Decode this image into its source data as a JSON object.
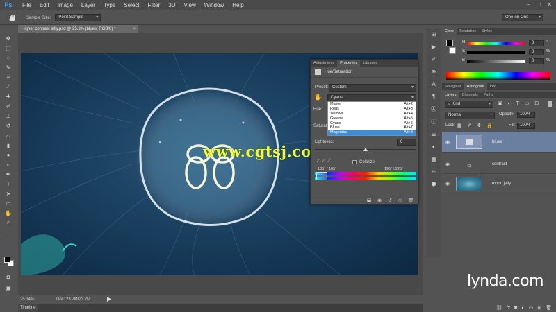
{
  "menu": {
    "logo": "Ps",
    "items": [
      "File",
      "Edit",
      "Image",
      "Layer",
      "Type",
      "Select",
      "Filter",
      "3D",
      "View",
      "Window",
      "Help"
    ]
  },
  "window_controls": [
    "–",
    "□",
    "✕"
  ],
  "options": {
    "sample_size_label": "Sample Size:",
    "sample_size_value": "Point Sample",
    "workspace": "One-on-One"
  },
  "document": {
    "tab_title": "Higher contrast jelly.psd @ 25.3% (blues, RGB/8) *",
    "tab_close": "×",
    "zoom": "25.34%",
    "doc_size": "Doc: 23.7M/23.7M",
    "watermark": "www.cgtsj.com"
  },
  "timeline_label": "Timeline",
  "properties": {
    "tabs": [
      "Adjustments",
      "Properties",
      "Libraries"
    ],
    "active_tab": "Properties",
    "title": "Hue/Saturation",
    "preset_label": "Preset:",
    "preset_value": "Custom",
    "channel_value": "Cyans",
    "channels": [
      {
        "name": "Master",
        "key": "Alt+2"
      },
      {
        "name": "Reds",
        "key": "Alt+3"
      },
      {
        "name": "Yellows",
        "key": "Alt+4"
      },
      {
        "name": "Greens",
        "key": "Alt+5"
      },
      {
        "name": "Cyans",
        "key": "Alt+6"
      },
      {
        "name": "Blues",
        "key": "Alt+7"
      },
      {
        "name": "Magentas",
        "key": "Alt+8"
      }
    ],
    "selected_channel_index": 6,
    "hue_label": "Hue:",
    "saturation_label": "Saturati",
    "lightness_label": "Lightness:",
    "lightness_value": "0",
    "colorize_label": "Colorize",
    "range_left": "135° / 165°",
    "range_right": "195° \\ 225°"
  },
  "color_panel": {
    "tabs": [
      "Color",
      "Swatches",
      "Styles"
    ],
    "active_tab": "Color",
    "h_label": "H",
    "s_label": "S",
    "b_label": "B",
    "h_value": "0",
    "s_value": "0",
    "b_value": "0",
    "percent": "%"
  },
  "nav_panel": {
    "tabs": [
      "Navigator",
      "Histogram",
      "Info"
    ],
    "active_tab": "Histogram"
  },
  "layers_panel": {
    "tabs": [
      "Layers",
      "Channels",
      "Paths"
    ],
    "active_tab": "Layers",
    "filter_kind": "Kind",
    "blend_mode": "Normal",
    "opacity_label": "Opacity:",
    "opacity_value": "100%",
    "lock_label": "Lock:",
    "fill_label": "Fill:",
    "fill_value": "100%",
    "layers": [
      {
        "name": "blues",
        "selected": true
      },
      {
        "name": "contrast",
        "selected": false
      },
      {
        "name": "moon jelly",
        "selected": false
      }
    ]
  },
  "brand": "lynda.com",
  "colors": {
    "accent_blue": "#3b8fd8",
    "selected_layer": "#6b7fa0",
    "watermark": "#f6ff2a",
    "app_bg": "#535353"
  }
}
